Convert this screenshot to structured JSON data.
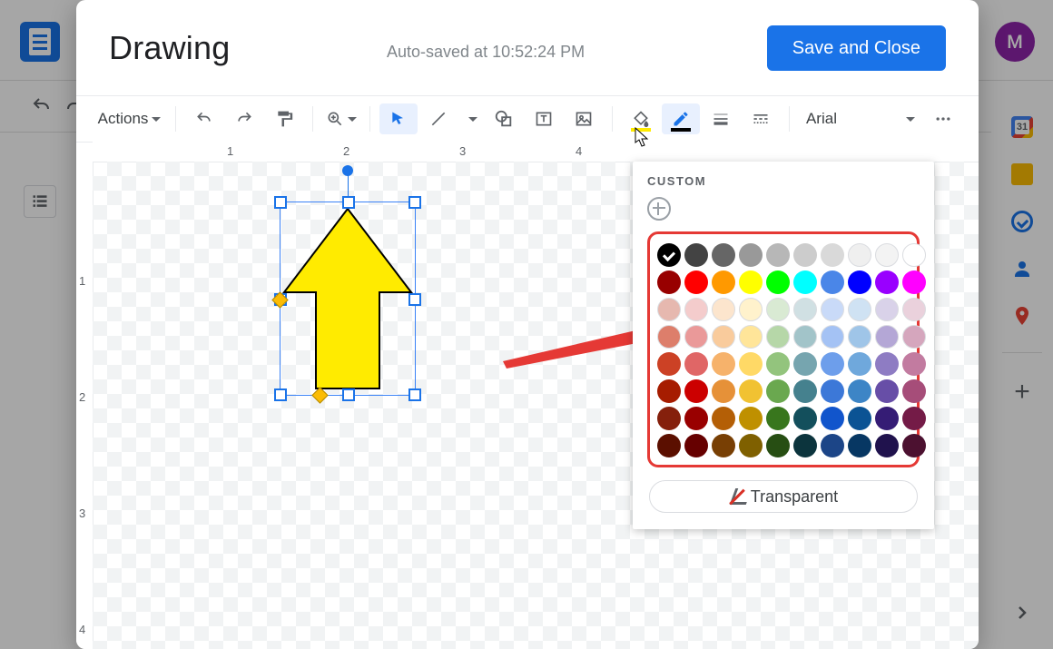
{
  "backdrop": {
    "avatar_letter": "M",
    "calendar_day": "31"
  },
  "dialog": {
    "title": "Drawing",
    "autosave": "Auto-saved at 10:52:24 PM",
    "save_button": "Save and Close"
  },
  "toolbar": {
    "actions_label": "Actions",
    "font": "Arial"
  },
  "ruler": {
    "top": [
      "1",
      "2",
      "3",
      "4"
    ],
    "left": [
      "1",
      "2",
      "3",
      "4"
    ]
  },
  "shape": {
    "type": "up-arrow",
    "fill": "#ffeb00",
    "stroke": "#000000"
  },
  "popover": {
    "custom_label": "CUSTOM",
    "transparent_label": "Transparent",
    "selected_color": "#000000",
    "rows": [
      [
        "#000000",
        "#434343",
        "#666666",
        "#999999",
        "#b7b7b7",
        "#cccccc",
        "#d9d9d9",
        "#efefef",
        "#f3f3f3",
        "#ffffff"
      ],
      [
        "#980000",
        "#ff0000",
        "#ff9900",
        "#ffff00",
        "#00ff00",
        "#00ffff",
        "#4a86e8",
        "#0000ff",
        "#9900ff",
        "#ff00ff"
      ],
      [
        "#e6b8af",
        "#f4cccc",
        "#fce5cd",
        "#fff2cc",
        "#d9ead3",
        "#d0e0e3",
        "#c9daf8",
        "#cfe2f3",
        "#d9d2e9",
        "#ead1dc"
      ],
      [
        "#dd7e6b",
        "#ea9999",
        "#f9cb9c",
        "#ffe599",
        "#b6d7a8",
        "#a2c4c9",
        "#a4c2f4",
        "#9fc5e8",
        "#b4a7d6",
        "#d5a6bd"
      ],
      [
        "#cc4125",
        "#e06666",
        "#f6b26b",
        "#ffd966",
        "#93c47d",
        "#76a5af",
        "#6d9eeb",
        "#6fa8dc",
        "#8e7cc3",
        "#c27ba0"
      ],
      [
        "#a61c00",
        "#cc0000",
        "#e69138",
        "#f1c232",
        "#6aa84f",
        "#45818e",
        "#3c78d8",
        "#3d85c6",
        "#674ea7",
        "#a64d79"
      ],
      [
        "#85200c",
        "#990000",
        "#b45f06",
        "#bf9000",
        "#38761d",
        "#134f5c",
        "#1155cc",
        "#0b5394",
        "#351c75",
        "#741b47"
      ],
      [
        "#5b0f00",
        "#660000",
        "#783f04",
        "#7f6000",
        "#274e13",
        "#0c343d",
        "#1c4587",
        "#073763",
        "#20124d",
        "#4c1130"
      ]
    ]
  }
}
